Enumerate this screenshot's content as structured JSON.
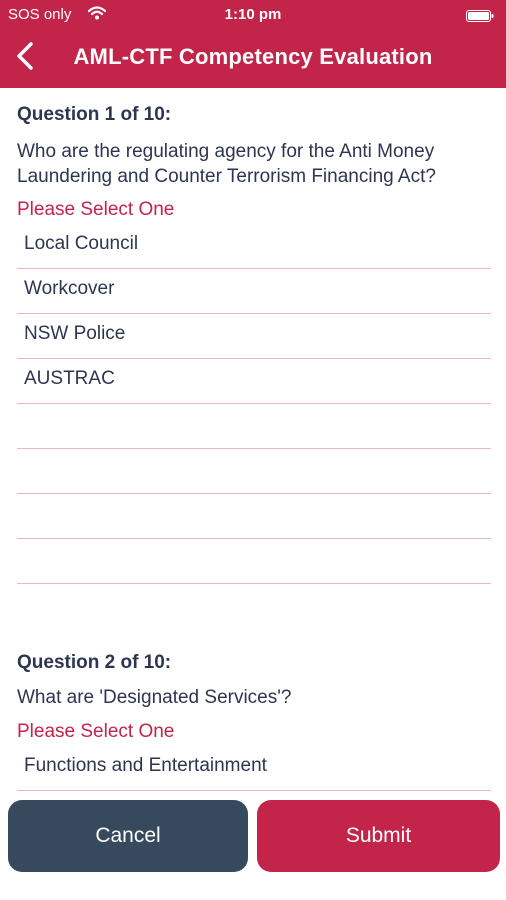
{
  "status_bar": {
    "carrier": "SOS only",
    "time": "1:10 pm"
  },
  "nav": {
    "title": "AML-CTF Competency Evaluation"
  },
  "questions": [
    {
      "number_label": "Question 1 of 10:",
      "text_line1": "Who are the regulating agency for the Anti Money",
      "text_line2": "Laundering and Counter Terrorism Financing Act?",
      "prompt": "Please Select One",
      "options": [
        "Local Council",
        "Workcover",
        "NSW Police",
        "AUSTRAC"
      ]
    },
    {
      "number_label": "Question 2 of 10:",
      "text_line1": "What are 'Designated Services'?",
      "prompt": "Please Select One",
      "options": [
        "Functions and Entertainment"
      ]
    }
  ],
  "buttons": {
    "cancel": "Cancel",
    "submit": "Submit"
  },
  "colors": {
    "brand": "#c2244a",
    "cancel": "#37495d",
    "text": "#2c3650",
    "divider": "#e9b7c3"
  }
}
